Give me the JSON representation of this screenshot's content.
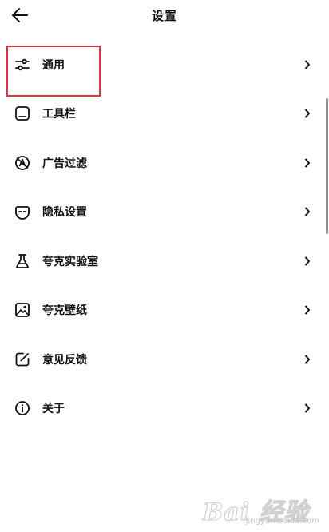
{
  "header": {
    "title": "设置",
    "back_icon": "arrow-left-icon"
  },
  "menu": {
    "items": [
      {
        "label": "通用",
        "icon": "sliders-icon"
      },
      {
        "label": "工具栏",
        "icon": "toolbar-icon"
      },
      {
        "label": "广告过滤",
        "icon": "ad-filter-icon"
      },
      {
        "label": "隐私设置",
        "icon": "privacy-mask-icon"
      },
      {
        "label": "夸克实验室",
        "icon": "flask-icon"
      },
      {
        "label": "夸克壁纸",
        "icon": "wallpaper-image-icon"
      },
      {
        "label": "意见反馈",
        "icon": "feedback-edit-icon"
      },
      {
        "label": "关于",
        "icon": "info-icon"
      }
    ]
  },
  "watermark": {
    "brand": "Bai 经验",
    "sub": "jingyan.baidu.com"
  },
  "colors": {
    "highlight": "#d9363e",
    "text": "#111111",
    "background": "#ffffff"
  }
}
